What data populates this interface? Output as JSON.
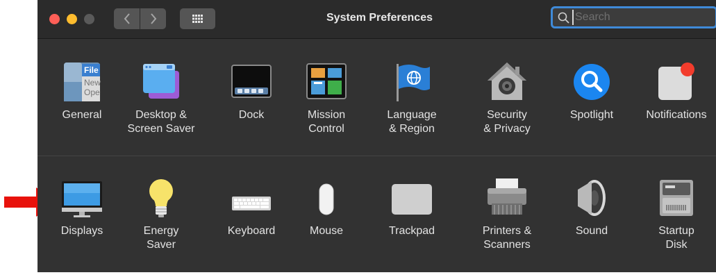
{
  "window": {
    "title": "System Preferences"
  },
  "search": {
    "placeholder": "Search",
    "value": ""
  },
  "row1": [
    {
      "name": "general",
      "label": "General",
      "icon": "general-icon"
    },
    {
      "name": "desktop-screen-saver",
      "label": "Desktop &\nScreen Saver",
      "icon": "desktop-screen-saver-icon"
    },
    {
      "name": "dock",
      "label": "Dock",
      "icon": "dock-icon"
    },
    {
      "name": "mission-control",
      "label": "Mission\nControl",
      "icon": "mission-control-icon"
    },
    {
      "name": "language-region",
      "label": "Language\n& Region",
      "icon": "globe-flag-icon"
    },
    {
      "name": "security-privacy",
      "label": "Security\n& Privacy",
      "icon": "house-lock-icon"
    },
    {
      "name": "spotlight",
      "label": "Spotlight",
      "icon": "magnifier-icon"
    },
    {
      "name": "notifications",
      "label": "Notifications",
      "icon": "notifications-icon"
    }
  ],
  "row2": [
    {
      "name": "displays",
      "label": "Displays",
      "icon": "monitor-icon"
    },
    {
      "name": "energy-saver",
      "label": "Energy\nSaver",
      "icon": "lightbulb-icon"
    },
    {
      "name": "keyboard",
      "label": "Keyboard",
      "icon": "keyboard-icon"
    },
    {
      "name": "mouse",
      "label": "Mouse",
      "icon": "mouse-icon"
    },
    {
      "name": "trackpad",
      "label": "Trackpad",
      "icon": "trackpad-icon"
    },
    {
      "name": "printers-scanners",
      "label": "Printers &\nScanners",
      "icon": "printer-icon"
    },
    {
      "name": "sound",
      "label": "Sound",
      "icon": "speaker-icon"
    },
    {
      "name": "startup-disk",
      "label": "Startup\nDisk",
      "icon": "hard-disk-icon"
    }
  ],
  "general_icon_text": {
    "line1": "File",
    "line2": "New",
    "line3": "Ope"
  },
  "colors": {
    "accent": "#3f8ad8",
    "annotation_arrow": "#e8120c"
  }
}
